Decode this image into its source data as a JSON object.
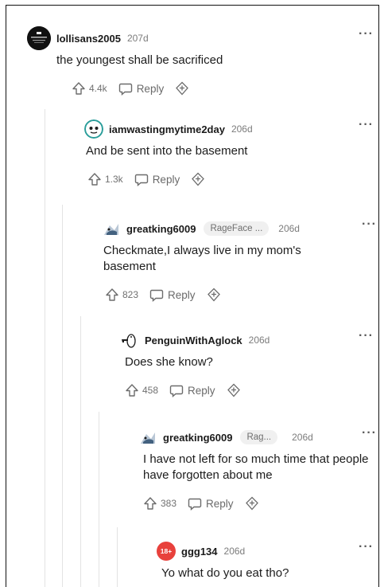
{
  "comments": [
    {
      "username": "lollisans2005",
      "age": "207d",
      "flair": "",
      "text": "the youngest shall be sacrificed",
      "votes": "4.4k",
      "reply": "Reply",
      "more": "···"
    },
    {
      "username": "iamwastingmytime2day",
      "age": "206d",
      "flair": "",
      "text": "And be sent into the basement",
      "votes": "1.3k",
      "reply": "Reply",
      "more": "···"
    },
    {
      "username": "greatking6009",
      "age": "206d",
      "flair": "RageFace ...",
      "text": "Checkmate,I always live in my mom's basement",
      "votes": "823",
      "reply": "Reply",
      "more": "···"
    },
    {
      "username": "PenguinWithAglock",
      "age": "206d",
      "flair": "",
      "text": "Does she know?",
      "votes": "458",
      "reply": "Reply",
      "more": "···"
    },
    {
      "username": "greatking6009",
      "age": "206d",
      "flair": "Rag...",
      "text": "I have not left for so much time that people have forgotten about me",
      "votes": "383",
      "reply": "Reply",
      "more": "···"
    },
    {
      "username": "ggg134",
      "age": "206d",
      "flair": "",
      "text": "Yo what do you eat tho?",
      "avatar_text": "18+",
      "more": "···"
    }
  ],
  "colors": {
    "nsfw_avatar": "#e8413c",
    "meta_gray": "#7c7c7c",
    "text": "#1c1c1c"
  },
  "icons": {
    "upvote": "upvote-arrow-icon",
    "reply": "reply-bubble-icon",
    "award": "award-icon",
    "more": "more-options-icon"
  }
}
